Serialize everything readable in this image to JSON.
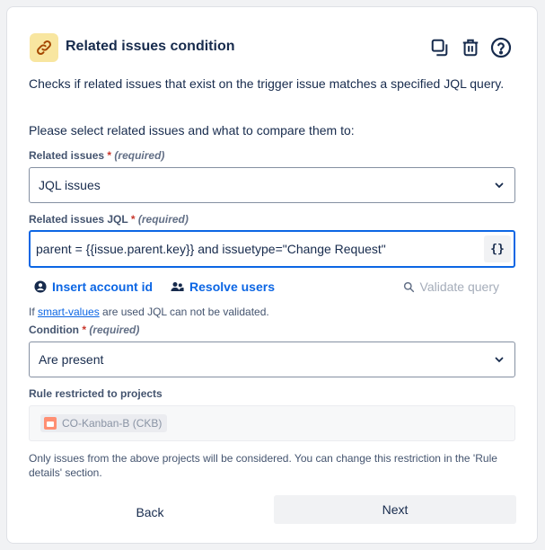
{
  "header": {
    "title": "Related issues condition",
    "icon": "link-icon",
    "actions": [
      "copy-icon",
      "trash-icon",
      "help-icon"
    ]
  },
  "description": "Checks if related issues that exist on the trigger issue matches a specified JQL query.",
  "instruction": "Please select related issues and what to compare them to:",
  "related_issues": {
    "label": "Related issues",
    "required_marker": "*",
    "required_text": "(required)",
    "value": "JQL issues"
  },
  "related_jql": {
    "label": "Related issues JQL",
    "required_marker": "*",
    "required_text": "(required)",
    "value": "parent = {{issue.parent.key}} and issuetype=\"Change Request\"",
    "smart_values_button": "{}"
  },
  "actions": {
    "insert_account_id": "Insert account id",
    "resolve_users": "Resolve users",
    "validate_query": "Validate query"
  },
  "hint": {
    "prefix": "If ",
    "link": "smart-values",
    "suffix": " are used JQL can not be validated."
  },
  "condition": {
    "label": "Condition",
    "required_marker": "*",
    "required_text": "(required)",
    "value": "Are present"
  },
  "restricted": {
    "label": "Rule restricted to projects",
    "project": "CO-Kanban-B (CKB)"
  },
  "note": "Only issues from the above projects will be considered. You can change this restriction in the 'Rule details' section.",
  "footer": {
    "back": "Back",
    "next": "Next"
  },
  "colors": {
    "accent": "#0c66e4",
    "required": "#c9372c",
    "icon_bg": "#f8e6a0"
  }
}
